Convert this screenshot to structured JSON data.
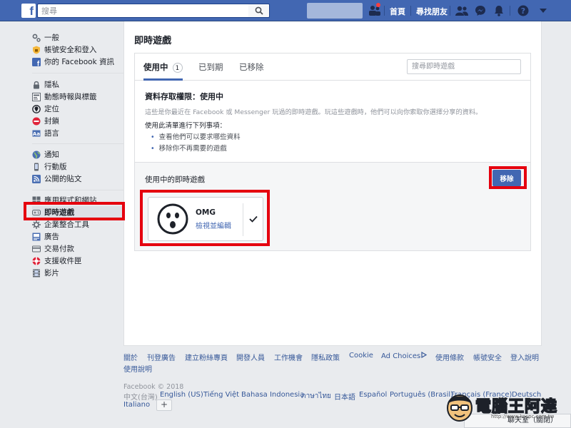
{
  "header": {
    "search_placeholder": "搜尋",
    "home_label": "首頁",
    "find_friends_label": "尋找朋友",
    "colors": {
      "bar": "#4267b2",
      "accent": "#e5000e"
    }
  },
  "sidebar": {
    "items": [
      {
        "label": "一般",
        "icon": "gear-icon"
      },
      {
        "label": "帳號安全和登入",
        "icon": "shield-icon"
      },
      {
        "label": "你的 Facebook 資訊",
        "icon": "facebook-icon"
      },
      {
        "label": "隱私",
        "icon": "lock-icon"
      },
      {
        "label": "動態時報與標籤",
        "icon": "timeline-icon"
      },
      {
        "label": "定位",
        "icon": "location-icon"
      },
      {
        "label": "封鎖",
        "icon": "block-icon"
      },
      {
        "label": "語言",
        "icon": "language-icon"
      },
      {
        "label": "通知",
        "icon": "globe-icon"
      },
      {
        "label": "行動版",
        "icon": "mobile-icon"
      },
      {
        "label": "公開的貼文",
        "icon": "rss-icon"
      },
      {
        "label": "應用程式和網站",
        "icon": "apps-icon"
      },
      {
        "label": "即時遊戲",
        "icon": "game-controller-icon",
        "active": true
      },
      {
        "label": "企業整合工具",
        "icon": "puzzle-icon"
      },
      {
        "label": "廣告",
        "icon": "ads-icon"
      },
      {
        "label": "交易付款",
        "icon": "card-icon"
      },
      {
        "label": "支援收件匣",
        "icon": "lifebuoy-icon"
      },
      {
        "label": "影片",
        "icon": "film-icon"
      }
    ]
  },
  "main": {
    "title": "即時遊戲",
    "tabs": [
      {
        "label": "使用中",
        "count": "1",
        "active": true
      },
      {
        "label": "已到期"
      },
      {
        "label": "已移除"
      }
    ],
    "tab_search_placeholder": "搜尋即時遊戲",
    "permission": {
      "title": "資料存取權限：使用中",
      "description": "這些是你最近在 Facebook 或 Messenger 玩過的即時遊戲。玩這些遊戲時，他們可以向你索取你選擇分享的資料。",
      "subheading": "使用此清單進行下列事項：",
      "bullets": [
        "查看他們可以要求哪些資料",
        "移除你不再需要的遊戲"
      ]
    },
    "active_games": {
      "label": "使用中的即時遊戲",
      "remove_button": "移除",
      "games": [
        {
          "name": "OMG",
          "edit_link": "檢視並編輯",
          "checked": true
        }
      ]
    }
  },
  "footer": {
    "links": [
      "關於",
      "刊登廣告",
      "建立粉絲專頁",
      "開發人員",
      "工作機會",
      "隱私政策",
      "Cookie",
      "Ad Choices",
      "使用條款",
      "帳號安全",
      "登入說明",
      "使用說明"
    ],
    "copyright": "Facebook © 2018",
    "current_language": "中文(台灣)",
    "languages": [
      "English (US)",
      "Tiếng Việt",
      "Bahasa Indonesia",
      "ภาษาไทย",
      "日本語",
      "Español",
      "Português (Brasil)",
      "Français (France)",
      "Deutsch",
      "Italiano"
    ],
    "add_language": "+"
  },
  "chat": {
    "label": "聊天室（關閉）"
  },
  "watermark": {
    "text": "電腦王阿達",
    "url": "http://www.kocpc.com.tw"
  }
}
